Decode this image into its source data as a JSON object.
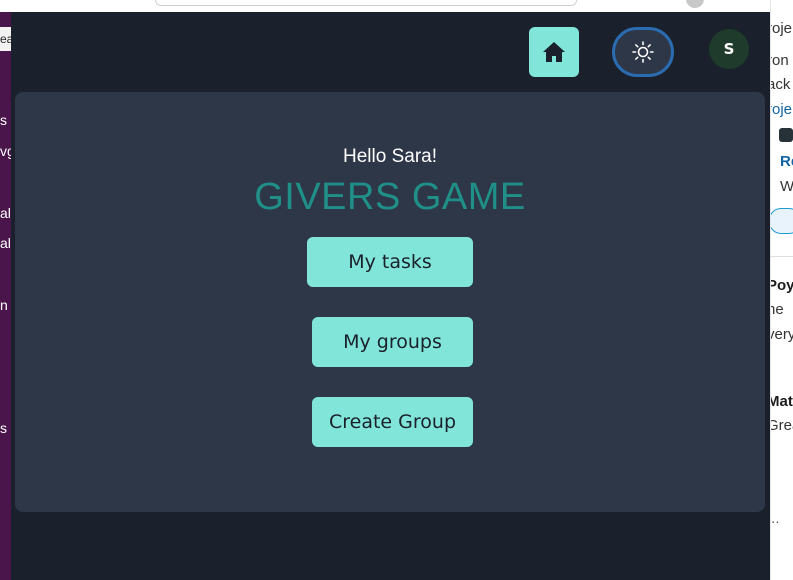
{
  "header": {
    "home_icon": "home-icon",
    "theme_icon": "sun-icon",
    "avatar_initial": "S"
  },
  "main": {
    "greeting": "Hello Sara!",
    "title": "GIVERS GAME",
    "buttons": {
      "tasks": "My tasks",
      "groups": "My groups",
      "create_group": "Create Group"
    }
  },
  "colors": {
    "background": "#1a202c",
    "card": "#2d3748",
    "accent_button": "#81e6d9",
    "title_teal": "#1f8f87",
    "focus_ring": "#2b6cb0"
  },
  "left_fragments": [
    "ea",
    "s",
    "vg",
    "al",
    "al",
    "n",
    "s"
  ],
  "right_fragments": [
    "roje",
    "ron",
    "ack",
    "roje",
    "Re",
    "W",
    "Poya",
    "he",
    "very",
    "Mat",
    "Grea",
    "..."
  ]
}
